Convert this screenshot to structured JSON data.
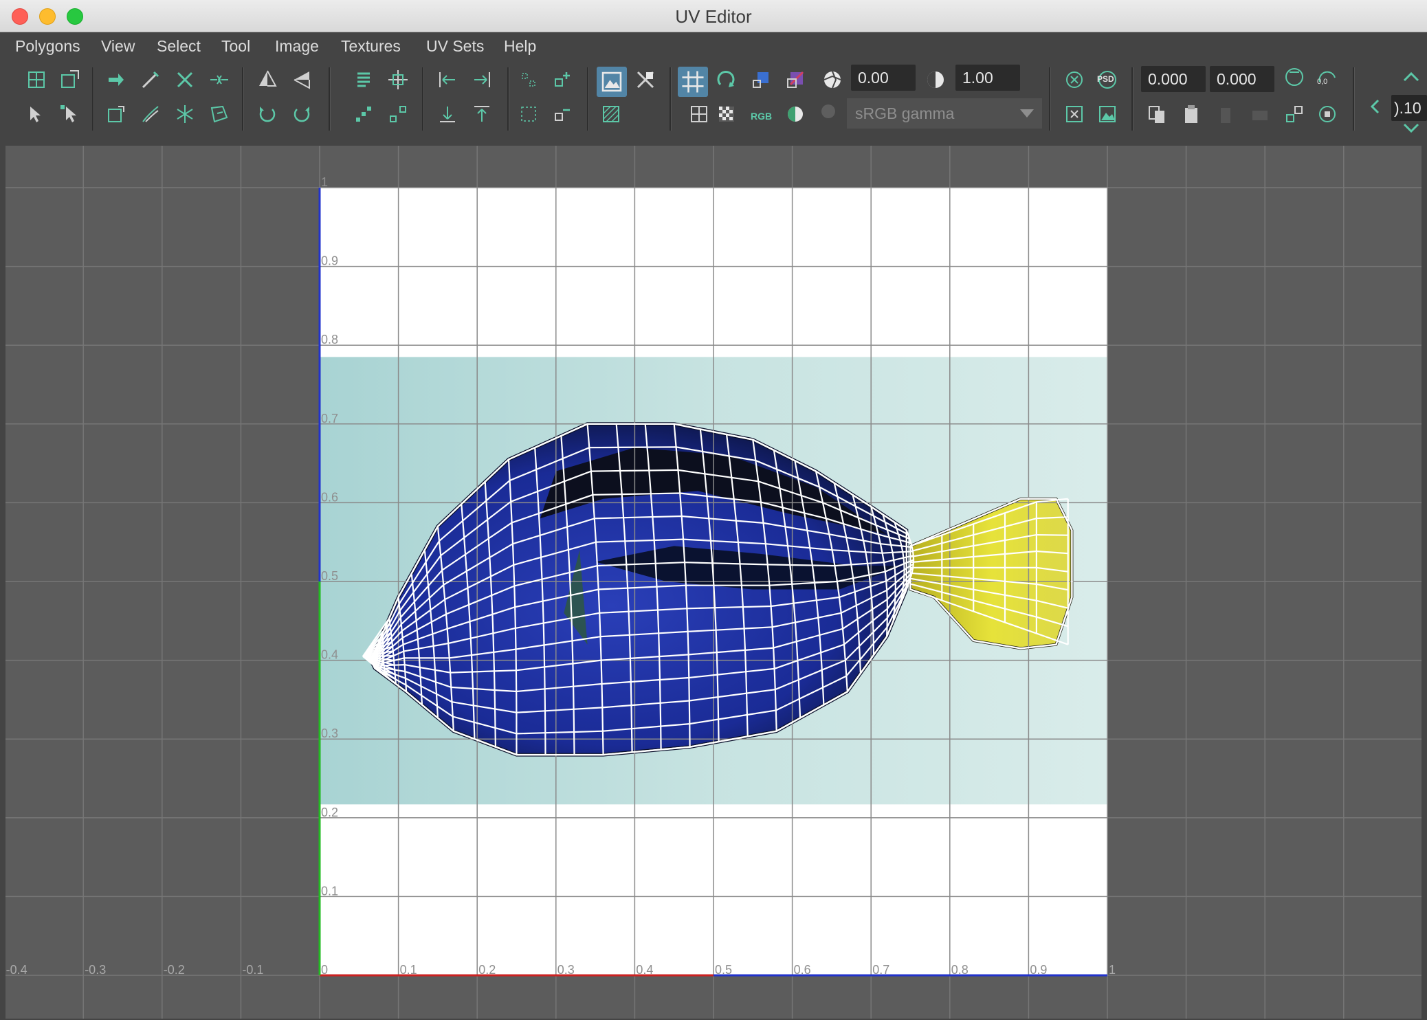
{
  "window": {
    "title": "UV Editor"
  },
  "menu": {
    "items": [
      "Polygons",
      "View",
      "Select",
      "Tool",
      "Image",
      "Textures",
      "UV Sets",
      "Help"
    ]
  },
  "toolbar": {
    "exposure_value": "0.00",
    "gamma_value": "1.00",
    "color_space": "sRGB gamma",
    "u_value": "0.000",
    "v_value": "0.000",
    "step_value": ").10",
    "psd_label": "PSD",
    "rgb_label": "RGB",
    "origin_label": "0,0"
  },
  "colors": {
    "accent": "#5cc8a8",
    "active_button": "#5285a6",
    "u_axis": "#cc2222",
    "v_axis_low": "#22bb22",
    "v_axis_high": "#2233cc"
  },
  "axes": {
    "u_ticks_negative": [
      "-0.4",
      "-0.3",
      "-0.2",
      "-0.1"
    ],
    "u_ticks": [
      "0",
      "0.1",
      "0.2",
      "0.3",
      "0.4",
      "0.5",
      "0.6",
      "0.7",
      "0.8",
      "0.9",
      "1"
    ],
    "v_ticks": [
      "0.1",
      "0.2",
      "0.3",
      "0.4",
      "0.5",
      "0.6",
      "0.7",
      "0.8",
      "0.9",
      "1"
    ]
  },
  "texture": {
    "v_range": [
      0.217,
      0.785
    ],
    "u_range": [
      0,
      1
    ],
    "subject": "blue-tang-fish"
  }
}
